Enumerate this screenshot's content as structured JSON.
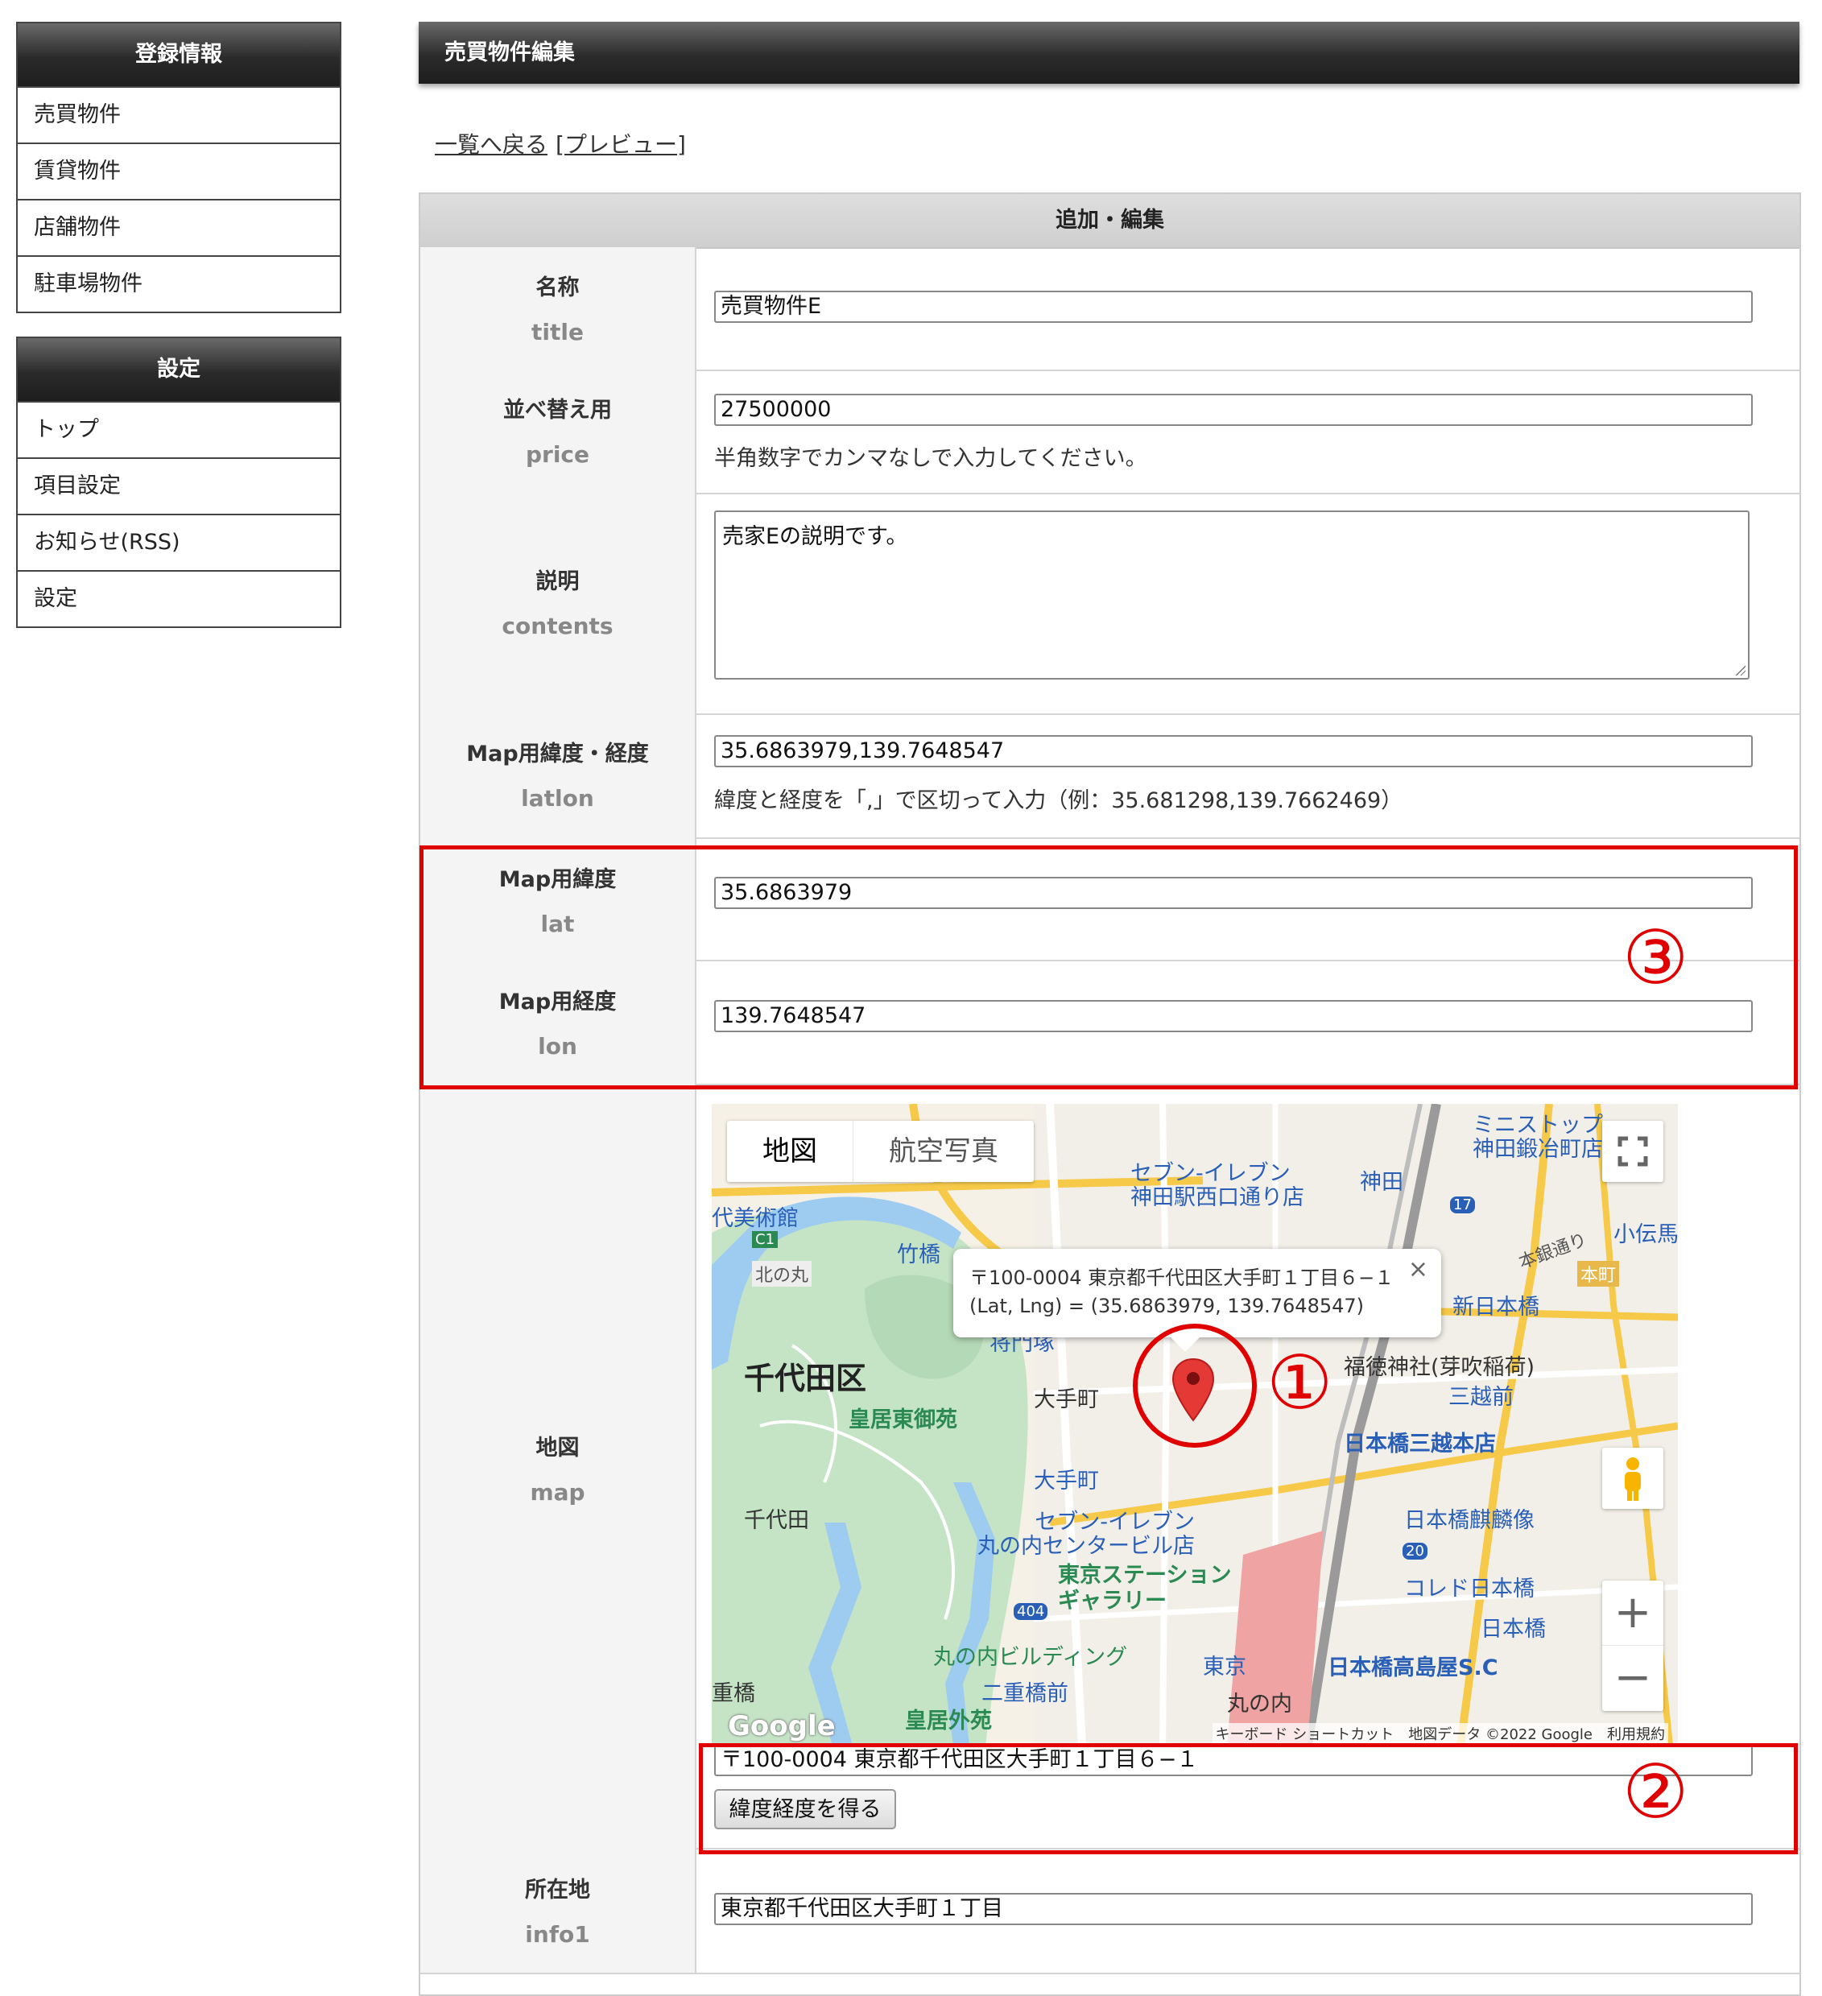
{
  "sidebar": {
    "registration": {
      "title": "登録情報",
      "items": [
        "売買物件",
        "賃貸物件",
        "店舗物件",
        "駐車場物件"
      ]
    },
    "settings": {
      "title": "設定",
      "items": [
        "トップ",
        "項目設定",
        "お知らせ(RSS)",
        "設定"
      ]
    }
  },
  "page": {
    "title": "売買物件編集",
    "back_link": "一覧へ戻る",
    "preview_link": "[プレビュー]",
    "table_header": "追加・編集"
  },
  "fields": {
    "title": {
      "label": "名称",
      "key": "title",
      "value": "売買物件E"
    },
    "price": {
      "label": "並べ替え用",
      "key": "price",
      "value": "27500000",
      "note": "半角数字でカンマなしで入力してください。"
    },
    "contents": {
      "label": "説明",
      "key": "contents",
      "value": "売家Eの説明です。"
    },
    "latlon": {
      "label": "Map用緯度・経度",
      "key": "latlon",
      "value": "35.6863979,139.7648547",
      "note": "緯度と経度を「,」で区切って入力（例：35.681298,139.7662469）"
    },
    "lat": {
      "label": "Map用緯度",
      "key": "lat",
      "value": "35.6863979"
    },
    "lon": {
      "label": "Map用経度",
      "key": "lon",
      "value": "139.7648547"
    },
    "map": {
      "label": "地図",
      "key": "map",
      "address_value": "〒100-0004 東京都千代田区大手町１丁目６−１",
      "button": "緯度経度を得る"
    },
    "info1": {
      "label": "所在地",
      "key": "info1",
      "value": "東京都千代田区大手町１丁目"
    }
  },
  "map": {
    "tab_map": "地図",
    "tab_satellite": "航空写真",
    "info_line1": "〒100-0004 東京都千代田区大手町１丁目６−１",
    "info_line2": "(Lat, Lng) = (35.6863979, 139.7648547)",
    "zoom_in": "+",
    "zoom_out": "−",
    "close": "×",
    "google": "Google",
    "footer": "キーボード ショートカット　地図データ ©2022 Google　利用規約",
    "labels": {
      "chiyoda": "千代田区",
      "koukyo_higashi": "皇居東御苑",
      "koukyo_gaien": "皇居外苑",
      "chiyoda_small": "千代田",
      "otemachi": "大手町",
      "otemachi_pin": "大手町",
      "tokyo_station_gallery": "東京ステーション\nギャラリー",
      "tokyo": "東京",
      "marunouchi": "丸の内",
      "marunouchi_bldg": "丸の内ビルディング",
      "nijubashimae": "二重橋前",
      "nihonbashi_mitsukoshi": "日本橋三越本店",
      "nihonbashi_kirin": "日本橋麒麟像",
      "nihonbashi_takashimaya": "日本橋高島屋S.C",
      "coredo": "コレド日本橋",
      "nihonbashi": "日本橋",
      "mitsukoshimae": "三越前",
      "shin_nihonbashi": "新日本橋",
      "fukutoku": "福徳神社(芽吹稲荷)",
      "kanda": "神田",
      "seven_kanda": "セブン-イレブン\n神田駅西口通り店",
      "seven_marunouchi": "セブン-イレブン\n丸の内センタービル店",
      "ministop": "ミニストップ\n神田鍛冶町店",
      "kodenma": "小伝馬",
      "takebashi": "竹橋",
      "kitanomaru": "北の丸",
      "bijutsukan": "代美術館",
      "shomonzuka": "将門塚",
      "honcho": "本町",
      "honginzoku": "本銀通り",
      "c1": "C1",
      "r17": "17",
      "r20": "20",
      "r404": "404",
      "jubashi": "重橋"
    }
  },
  "annotations": {
    "one": "①",
    "two": "②",
    "three": "③"
  },
  "colors": {
    "accent_red": "#e00000",
    "pin": "#e53935",
    "park": "#c4e3c4",
    "water": "#9ecbf0",
    "header_dark": "#2a2a2a"
  }
}
